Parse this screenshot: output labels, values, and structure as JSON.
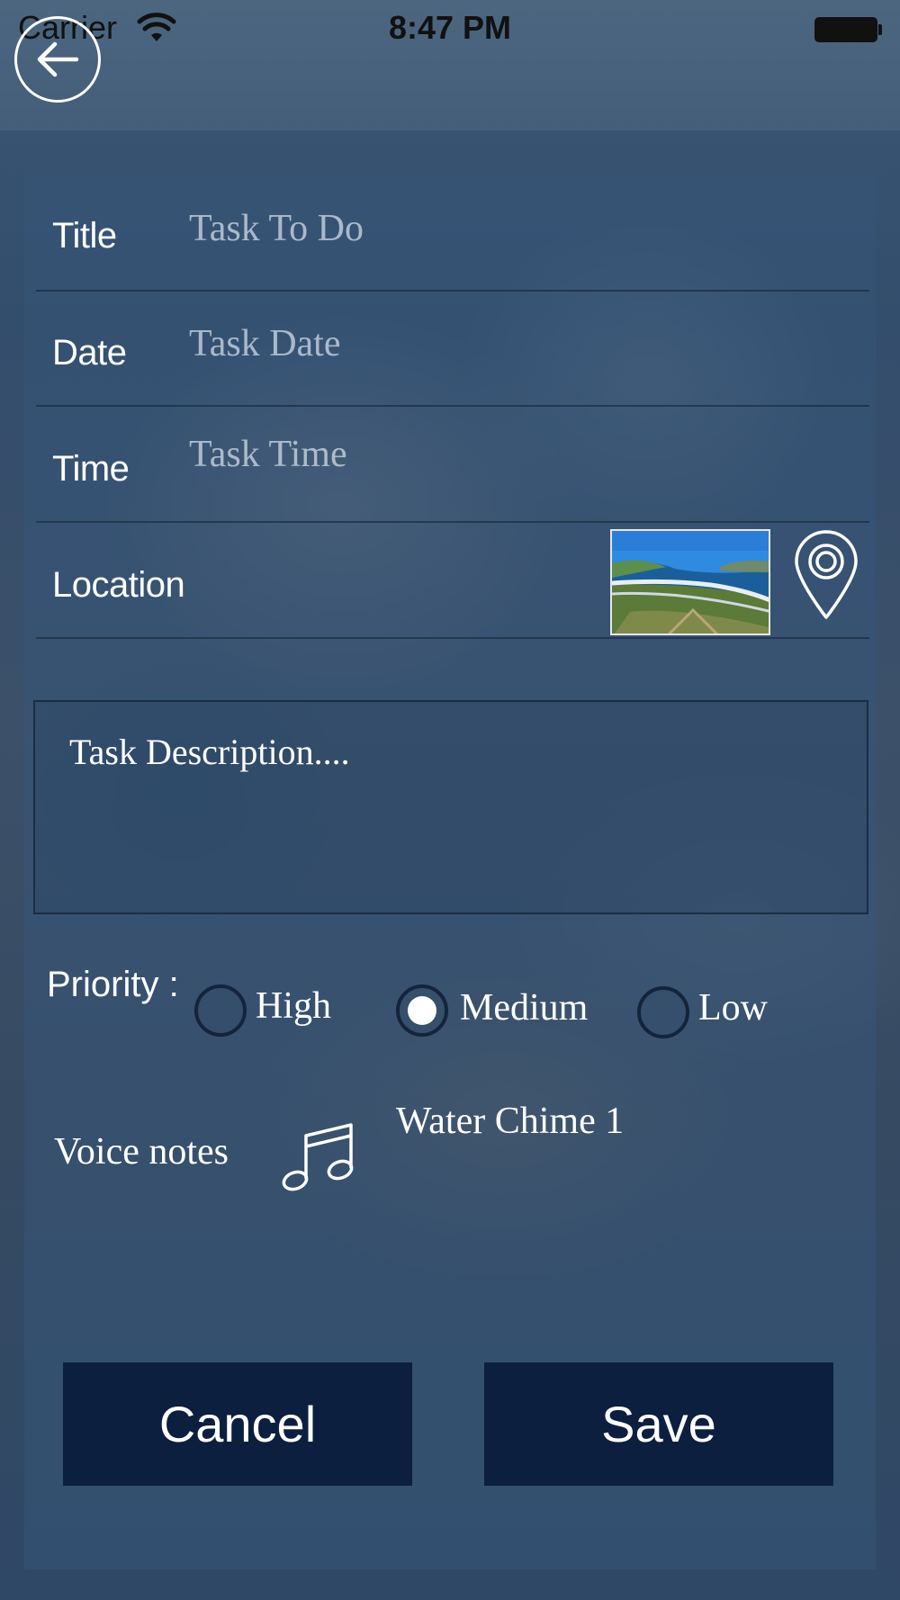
{
  "status_bar": {
    "carrier": "Carrier",
    "time": "8:47 PM"
  },
  "form": {
    "title": {
      "label": "Title",
      "placeholder": "Task To Do"
    },
    "date": {
      "label": "Date",
      "placeholder": "Task Date"
    },
    "time": {
      "label": "Time",
      "placeholder": "Task Time"
    },
    "location": {
      "label": "Location"
    },
    "description": {
      "placeholder": "Task Description...."
    },
    "priority": {
      "label": "Priority :",
      "options": [
        "High",
        "Medium",
        "Low"
      ],
      "selected": "Medium"
    },
    "voice_notes": {
      "label": "Voice notes",
      "sound": "Water Chime 1"
    }
  },
  "actions": {
    "cancel_label": "Cancel",
    "save_label": "Save"
  },
  "icons": {
    "back": "arrow-left-circle-icon",
    "location": "map-pin-icon",
    "voice": "music-note-icon",
    "wifi": "wifi-icon",
    "battery": "battery-icon"
  },
  "colors": {
    "button_bg": "#0c1f3f",
    "radio_border": "#14243b",
    "text": "#ffffff"
  }
}
